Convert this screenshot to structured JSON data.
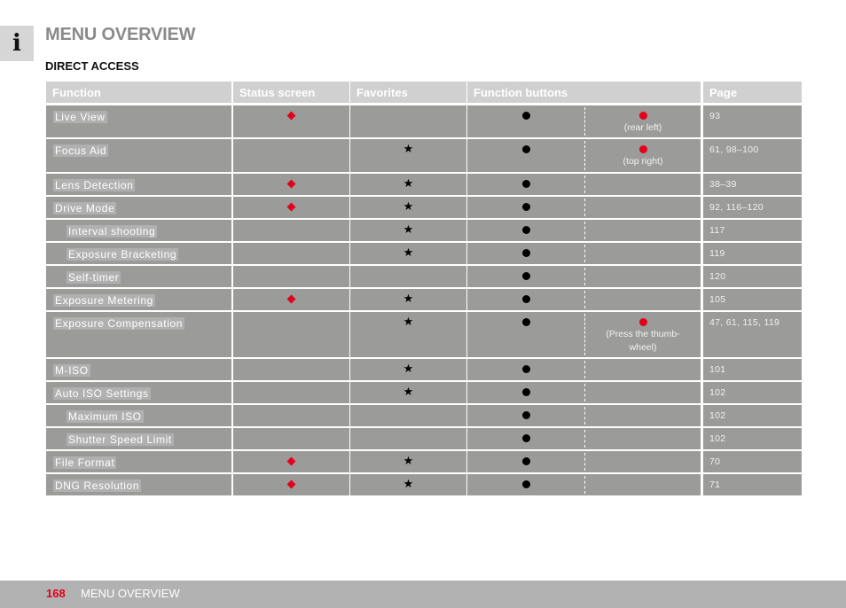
{
  "page": {
    "info_icon": "info-icon",
    "title": "MENU OVERVIEW",
    "section_title": "DIRECT ACCESS"
  },
  "table": {
    "headers": {
      "function": "Function",
      "status_screen": "Status screen",
      "favorites": "Favorites",
      "function_buttons": "Function buttons",
      "page": "Page"
    },
    "legend_icons": {
      "status_screen": "red-diamond-icon",
      "favorites": "star-icon",
      "function_buttons_general": "black-dot-icon",
      "function_buttons_dedicated": "red-dot-icon"
    },
    "colors": {
      "accent_red": "#e3001b",
      "cell_gray": "#9b9b9a",
      "header_gray": "#d0d0d0"
    },
    "rows": [
      {
        "function": "Live View",
        "indent": false,
        "status_screen": true,
        "favorites": false,
        "function_buttons": true,
        "dedicated_button": true,
        "dedicated_note": "(rear left)",
        "page": "93"
      },
      {
        "function": "Focus Aid",
        "indent": false,
        "status_screen": false,
        "favorites": true,
        "function_buttons": true,
        "dedicated_button": true,
        "dedicated_note": "(top right)",
        "page": "61, 98–100"
      },
      {
        "function": "Lens Detection",
        "indent": false,
        "status_screen": true,
        "favorites": true,
        "function_buttons": true,
        "dedicated_button": false,
        "dedicated_note": "",
        "page": "38–39"
      },
      {
        "function": "Drive Mode",
        "indent": false,
        "status_screen": true,
        "favorites": true,
        "function_buttons": true,
        "dedicated_button": false,
        "dedicated_note": "",
        "page": "92, 116–120"
      },
      {
        "function": "Interval shooting",
        "indent": true,
        "status_screen": false,
        "favorites": true,
        "function_buttons": true,
        "dedicated_button": false,
        "dedicated_note": "",
        "page": "117"
      },
      {
        "function": "Exposure Bracketing",
        "indent": true,
        "status_screen": false,
        "favorites": true,
        "function_buttons": true,
        "dedicated_button": false,
        "dedicated_note": "",
        "page": "119"
      },
      {
        "function": "Self-timer",
        "indent": true,
        "status_screen": false,
        "favorites": false,
        "function_buttons": true,
        "dedicated_button": false,
        "dedicated_note": "",
        "page": "120"
      },
      {
        "function": "Exposure Metering",
        "indent": false,
        "status_screen": true,
        "favorites": true,
        "function_buttons": true,
        "dedicated_button": false,
        "dedicated_note": "",
        "page": "105"
      },
      {
        "function": "Exposure Compensation",
        "indent": false,
        "status_screen": false,
        "favorites": true,
        "function_buttons": true,
        "dedicated_button": true,
        "dedicated_note": "(Press the thumb-wheel)",
        "page": "47, 61, 115, 119"
      },
      {
        "function": "M-ISO",
        "indent": false,
        "status_screen": false,
        "favorites": true,
        "function_buttons": true,
        "dedicated_button": false,
        "dedicated_note": "",
        "page": "101"
      },
      {
        "function": "Auto ISO Settings",
        "indent": false,
        "status_screen": false,
        "favorites": true,
        "function_buttons": true,
        "dedicated_button": false,
        "dedicated_note": "",
        "page": "102"
      },
      {
        "function": "Maximum ISO",
        "indent": true,
        "status_screen": false,
        "favorites": false,
        "function_buttons": true,
        "dedicated_button": false,
        "dedicated_note": "",
        "page": "102"
      },
      {
        "function": "Shutter Speed Limit",
        "indent": true,
        "status_screen": false,
        "favorites": false,
        "function_buttons": true,
        "dedicated_button": false,
        "dedicated_note": "",
        "page": "102"
      },
      {
        "function": "File Format",
        "indent": false,
        "status_screen": true,
        "favorites": true,
        "function_buttons": true,
        "dedicated_button": false,
        "dedicated_note": "",
        "page": "70"
      },
      {
        "function": "DNG Resolution",
        "indent": false,
        "status_screen": true,
        "favorites": true,
        "function_buttons": true,
        "dedicated_button": false,
        "dedicated_note": "",
        "page": "71"
      }
    ]
  },
  "footer": {
    "page_number": "168",
    "section": "MENU OVERVIEW"
  }
}
